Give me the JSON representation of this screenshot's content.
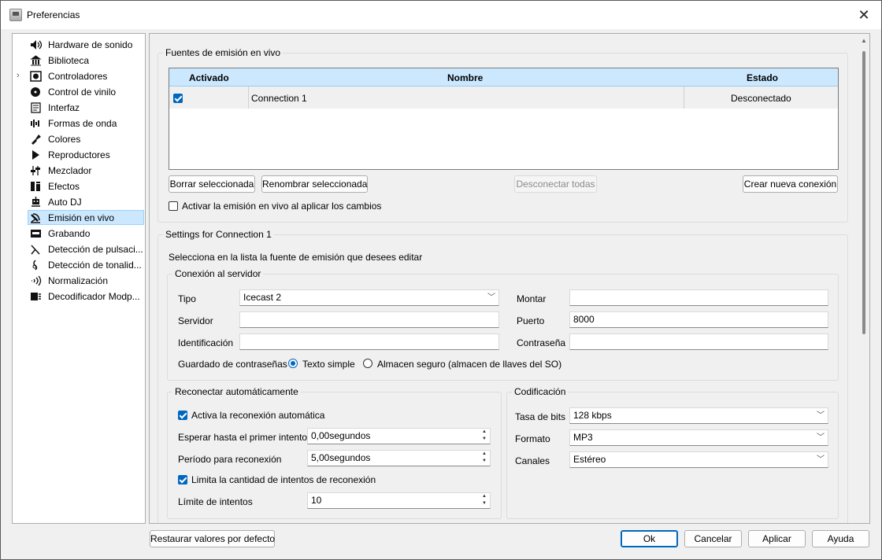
{
  "window": {
    "title": "Preferencias",
    "close_symbol": "✕"
  },
  "sidebar": {
    "items": [
      {
        "label": "Hardware de sonido",
        "icon": "speaker-icon"
      },
      {
        "label": "Biblioteca",
        "icon": "library-icon"
      },
      {
        "label": "Controladores",
        "icon": "controller-icon",
        "expandable": true
      },
      {
        "label": "Control de vinilo",
        "icon": "vinyl-icon"
      },
      {
        "label": "Interfaz",
        "icon": "interface-icon"
      },
      {
        "label": "Formas de onda",
        "icon": "waveform-icon"
      },
      {
        "label": "Colores",
        "icon": "paint-icon"
      },
      {
        "label": "Reproductores",
        "icon": "play-icon"
      },
      {
        "label": "Mezclador",
        "icon": "mixer-icon"
      },
      {
        "label": "Efectos",
        "icon": "effects-icon"
      },
      {
        "label": "Auto DJ",
        "icon": "robot-icon"
      },
      {
        "label": "Emisión en vivo",
        "icon": "broadcast-icon",
        "selected": true
      },
      {
        "label": "Grabando",
        "icon": "recording-icon"
      },
      {
        "label": "Detección de pulsaci...",
        "icon": "metronome-icon"
      },
      {
        "label": "Detección de tonalid...",
        "icon": "key-icon"
      },
      {
        "label": "Normalización",
        "icon": "normalize-icon"
      },
      {
        "label": "Decodificador Modp...",
        "icon": "decoder-icon"
      }
    ]
  },
  "sources": {
    "title": "Fuentes de emisión en vivo",
    "columns": {
      "enabled": "Activado",
      "name": "Nombre",
      "status": "Estado"
    },
    "rows": [
      {
        "enabled": true,
        "name": "Connection 1",
        "status": "Desconectado"
      }
    ],
    "buttons": {
      "delete": "Borrar seleccionada",
      "rename": "Renombrar seleccionada",
      "disconnect_all": "Desconectar todas",
      "create": "Crear nueva conexión"
    },
    "enable_on_apply": {
      "label": "Activar la emisión en vivo al aplicar los cambios",
      "checked": false
    }
  },
  "settings": {
    "title": "Settings for Connection 1",
    "hint": "Selecciona en la lista la fuente de emisión que desees editar",
    "server": {
      "title": "Conexión al servidor",
      "type_label": "Tipo",
      "type_value": "Icecast 2",
      "server_label": "Servidor",
      "server_value": "",
      "login_label": "Identificación",
      "login_value": "",
      "mount_label": "Montar",
      "mount_value": "",
      "port_label": "Puerto",
      "port_value": "8000",
      "password_label": "Contraseña",
      "password_value": "",
      "password_storage_label": "Guardado de contraseñas",
      "opt_plain": "Texto simple",
      "opt_secure": "Almacen seguro (almacen de llaves del SO)",
      "selected": "plain"
    },
    "reconnect": {
      "title": "Reconectar automáticamente",
      "enable_label": "Activa la reconexión automática",
      "enable_checked": true,
      "first_wait_label": "Esperar hasta el primer intento",
      "first_wait_value": "0,00segundos",
      "period_label": "Período para reconexión",
      "period_value": "5,00segundos",
      "limit_enable_label": "Limita la cantidad de intentos de reconexión",
      "limit_enable_checked": true,
      "limit_label": "Límite de intentos",
      "limit_value": "10"
    },
    "encoding": {
      "title": "Codificación",
      "bitrate_label": "Tasa de bits",
      "bitrate_value": "128 kbps",
      "format_label": "Formato",
      "format_value": "MP3",
      "channels_label": "Canales",
      "channels_value": "Estéreo"
    }
  },
  "footer": {
    "restore": "Restaurar valores por defecto",
    "ok": "Ok",
    "cancel": "Cancelar",
    "apply": "Aplicar",
    "help": "Ayuda"
  },
  "colors": {
    "accent": "#0067c0",
    "selection": "#cce8ff",
    "header": "#cce8ff"
  }
}
